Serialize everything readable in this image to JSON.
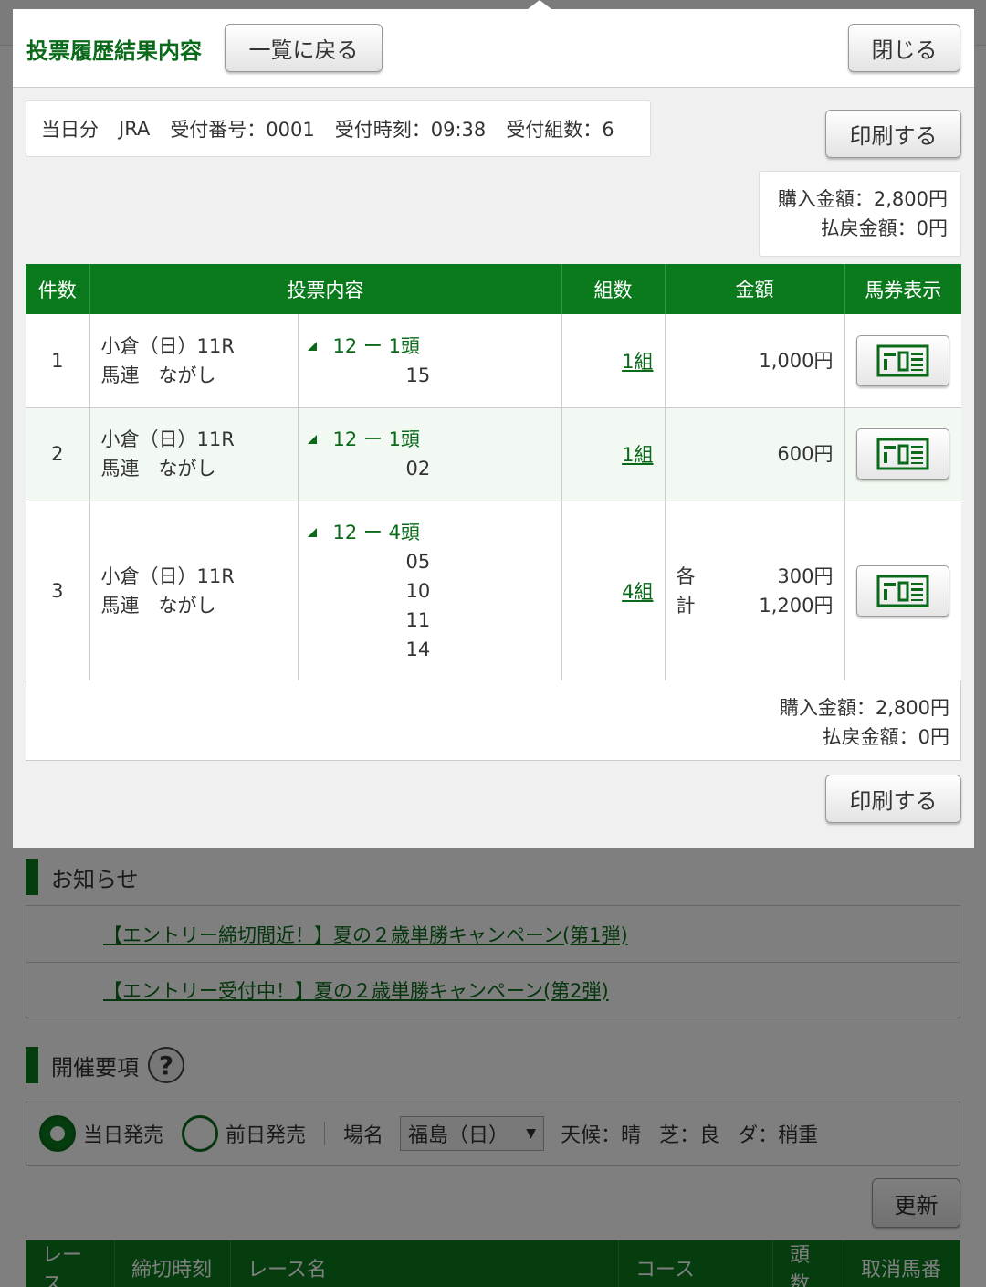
{
  "modal": {
    "title": "投票履歴結果内容",
    "back_label": "一覧に戻る",
    "close_label": "閉じる",
    "print_label": "印刷する",
    "info": {
      "day": "当日分",
      "org": "JRA",
      "receipt_no": "受付番号：0001",
      "receipt_time": "受付時刻：09:38",
      "receipt_sets": "受付組数：6"
    },
    "purchase_total": "購入金額：2,800円",
    "refund_total": "払戻金額：0円",
    "table": {
      "headers": [
        "件数",
        "投票内容",
        "組数",
        "金額",
        "馬券表示"
      ],
      "rows": [
        {
          "no": "1",
          "race": "小倉（日）11R",
          "bet_type": "馬連　ながし",
          "axis": "12 ー 1頭",
          "partners": [
            "15"
          ],
          "sets": "1組",
          "amount_label": "",
          "amount": "1,000円",
          "total_label": "",
          "total": ""
        },
        {
          "no": "2",
          "race": "小倉（日）11R",
          "bet_type": "馬連　ながし",
          "axis": "12 ー 1頭",
          "partners": [
            "02"
          ],
          "sets": "1組",
          "amount_label": "",
          "amount": "600円",
          "total_label": "",
          "total": ""
        },
        {
          "no": "3",
          "race": "小倉（日）11R",
          "bet_type": "馬連　ながし",
          "axis": "12 ー 4頭",
          "partners": [
            "05",
            "10",
            "11",
            "14"
          ],
          "sets": "4組",
          "amount_label": "各",
          "amount": "300円",
          "total_label": "計",
          "total": "1,200円"
        }
      ]
    },
    "ticket_icon": "ticket-view-icon"
  },
  "background": {
    "news_title": "お知らせ",
    "news_items": [
      "【エントリー締切間近！】夏の２歳単勝キャンペーン(第1弾)",
      "【エントリー受付中！】夏の２歳単勝キャンペーン(第2弾)"
    ],
    "event_title": "開催要項",
    "help_icon": "?",
    "radio_today": "当日発売",
    "radio_prev": "前日発売",
    "venue_label": "場名",
    "venue_value": "福島（日）",
    "weather": "天候：晴",
    "turf": "芝：良",
    "dirt": "ダ：稍重",
    "update_label": "更新",
    "race_headers": [
      "レース",
      "締切時刻",
      "レース名",
      "コース",
      "頭数",
      "取消馬番"
    ]
  },
  "colors": {
    "brand_green": "#0a7a1d",
    "link_green": "#0a6a1a"
  }
}
